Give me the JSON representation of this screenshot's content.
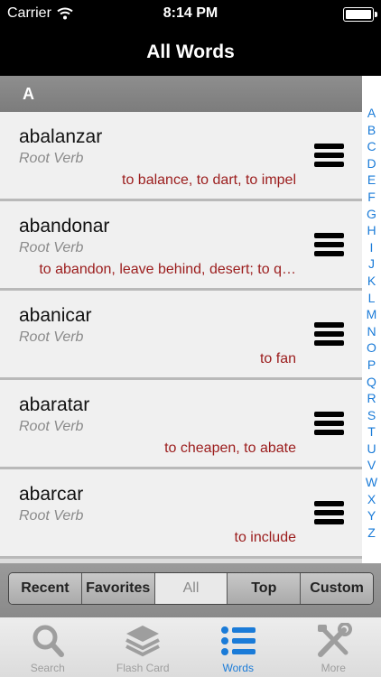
{
  "status": {
    "carrier": "Carrier",
    "time": "8:14 PM"
  },
  "nav": {
    "title": "All Words"
  },
  "section": {
    "letter": "A"
  },
  "words": [
    {
      "word": "abalanzar",
      "pos": "Root Verb",
      "meaning": "to balance, to dart, to impel"
    },
    {
      "word": "abandonar",
      "pos": "Root Verb",
      "meaning": "to abandon, leave behind, desert; to q…"
    },
    {
      "word": "abanicar",
      "pos": "Root Verb",
      "meaning": "to fan"
    },
    {
      "word": "abaratar",
      "pos": "Root Verb",
      "meaning": "to cheapen, to abate"
    },
    {
      "word": "abarcar",
      "pos": "Root Verb",
      "meaning": "to include"
    }
  ],
  "index": [
    "A",
    "B",
    "C",
    "D",
    "E",
    "F",
    "G",
    "H",
    "I",
    "J",
    "K",
    "L",
    "M",
    "N",
    "O",
    "P",
    "Q",
    "R",
    "S",
    "T",
    "U",
    "V",
    "W",
    "X",
    "Y",
    "Z"
  ],
  "segments": [
    {
      "label": "Recent",
      "active": false
    },
    {
      "label": "Favorites",
      "active": false
    },
    {
      "label": "All",
      "active": true
    },
    {
      "label": "Top",
      "active": false
    },
    {
      "label": "Custom",
      "active": false
    }
  ],
  "tabs": [
    {
      "label": "Search",
      "icon": "search-icon",
      "active": false
    },
    {
      "label": "Flash Card",
      "icon": "layers-icon",
      "active": false
    },
    {
      "label": "Words",
      "icon": "list-icon",
      "active": true
    },
    {
      "label": "More",
      "icon": "tools-icon",
      "active": false
    }
  ],
  "colors": {
    "accent": "#1a7bd8",
    "meaning": "#9b1c1c"
  }
}
